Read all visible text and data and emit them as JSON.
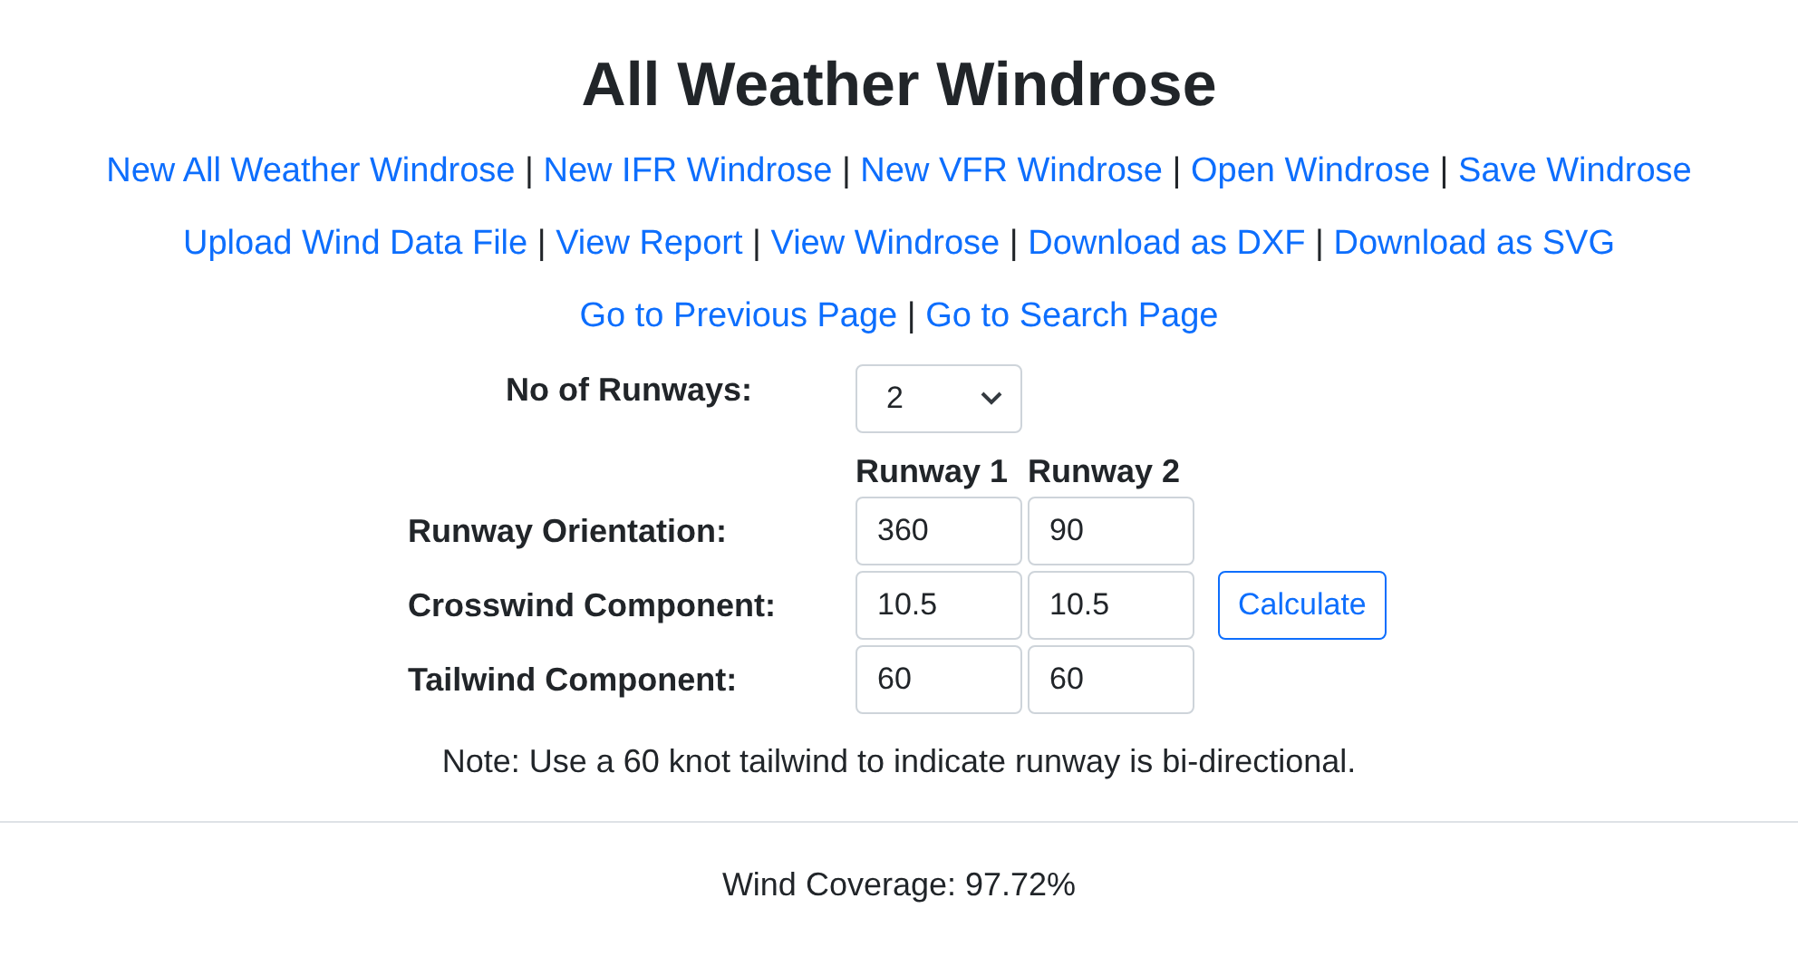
{
  "title": "All Weather Windrose",
  "link_rows": [
    {
      "separator": "|",
      "links": [
        "New All Weather Windrose",
        "New IFR Windrose",
        "New VFR Windrose",
        "Open Windrose",
        "Save Windrose"
      ]
    },
    {
      "separator": "|",
      "links": [
        "Upload Wind Data File",
        "View Report",
        "View Windrose",
        "Download as DXF",
        "Download as SVG"
      ]
    },
    {
      "separator": "|",
      "links": [
        "Go to Previous Page",
        "Go to Search Page"
      ]
    }
  ],
  "runway_count": {
    "label": "No of Runways:",
    "value": "2"
  },
  "table": {
    "columns": [
      "Runway 1",
      "Runway 2"
    ],
    "rows": [
      {
        "label": "Runway Orientation:",
        "values": [
          "360",
          "90"
        ]
      },
      {
        "label": "Crosswind Component:",
        "values": [
          "10.5",
          "10.5"
        ],
        "button": "Calculate"
      },
      {
        "label": "Tailwind Component:",
        "values": [
          "60",
          "60"
        ]
      }
    ]
  },
  "note": "Note: Use a 60 knot tailwind to indicate runway is bi-directional.",
  "result": "Wind Coverage: 97.72%"
}
